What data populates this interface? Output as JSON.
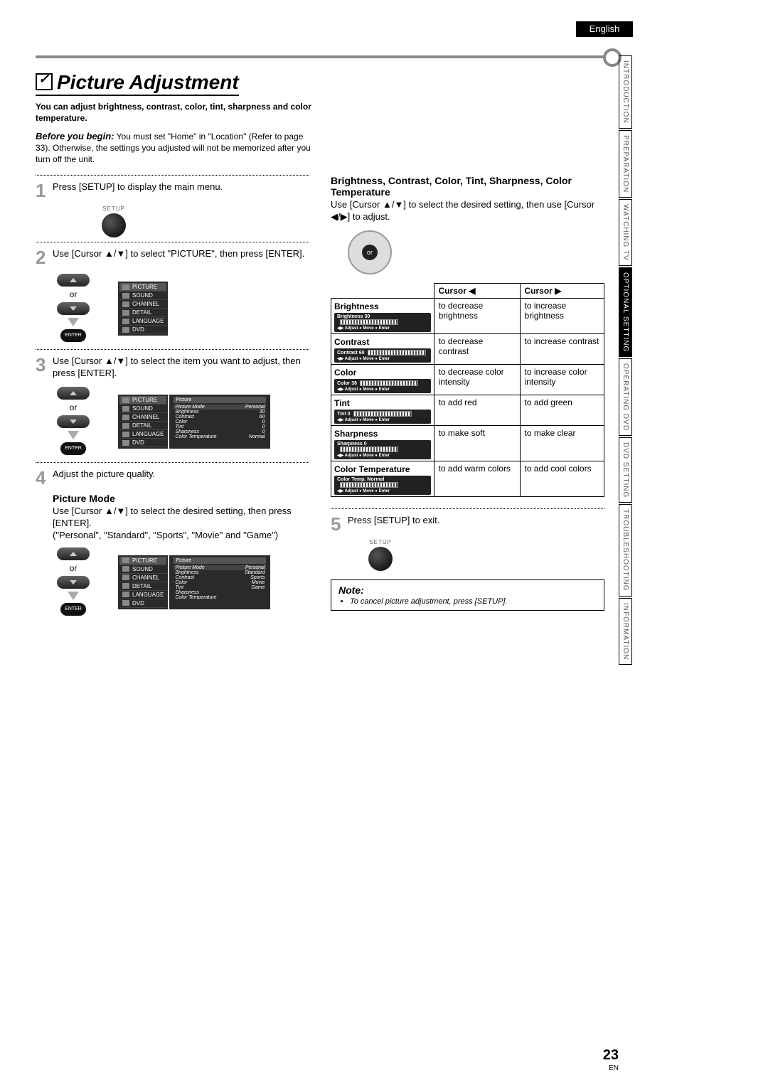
{
  "language": "English",
  "side_tabs": [
    "INTRODUCTION",
    "PREPARATION",
    "WATCHING TV",
    "OPTIONAL SETTING",
    "OPERATING DVD",
    "DVD SETTING",
    "TROUBLESHOOTING",
    "INFORMATION"
  ],
  "active_tab_index": 3,
  "title": "Picture Adjustment",
  "intro": "You can adjust brightness, contrast, color, tint, sharpness and color temperature.",
  "before_label": "Before you begin:",
  "before_text": "You must set \"Home\" in \"Location\" (Refer to page 33). Otherwise, the settings you adjusted will not be memorized after you turn off the unit.",
  "steps": {
    "s1": "Press [SETUP] to display the main menu.",
    "s2": "Use [Cursor ▲/▼] to select \"PICTURE\", then press [ENTER].",
    "s3": "Use [Cursor ▲/▼] to select the item you want to adjust, then press [ENTER].",
    "s4": "Adjust the picture quality.",
    "s5": "Press [SETUP] to exit."
  },
  "setup_label": "SETUP",
  "enter_label": "ENTER",
  "or": "or",
  "picture_mode_title": "Picture Mode",
  "picture_mode_desc1": "Use [Cursor ▲/▼] to select the desired setting, then press [ENTER].",
  "picture_mode_desc2": "(\"Personal\", \"Standard\", \"Sports\", \"Movie\" and \"Game\")",
  "right_title": "Brightness, Contrast, Color, Tint, Sharpness, Color Temperature",
  "right_desc": "Use [Cursor ▲/▼] to select the desired setting, then use [Cursor ◀/▶] to adjust.",
  "table_headers": {
    "left": "Cursor ◀",
    "right": "Cursor ▶"
  },
  "rows": [
    {
      "name": "Brightness",
      "val": "30",
      "left": "to decrease brightness",
      "right": "to increase brightness"
    },
    {
      "name": "Contrast",
      "val": "60",
      "left": "to decrease contrast",
      "right": "to increase contrast"
    },
    {
      "name": "Color",
      "val": "36",
      "left": "to decrease color intensity",
      "right": "to increase color intensity"
    },
    {
      "name": "Tint",
      "val": "0",
      "left": "to add red",
      "right": "to add green"
    },
    {
      "name": "Sharpness",
      "val": "0",
      "left": "to make soft",
      "right": "to make clear"
    },
    {
      "name": "Color Temperature",
      "val": "Normal",
      "label": "Color Temp.",
      "left": "to add warm colors",
      "right": "to add cool colors"
    }
  ],
  "slider_ctl": {
    "adjust": "Adjust",
    "move": "Move",
    "enter": "Enter"
  },
  "osd_menu": [
    "PICTURE",
    "SOUND",
    "CHANNEL",
    "DETAIL",
    "LANGUAGE",
    "DVD"
  ],
  "osd_picture": {
    "head": "Picture",
    "items": [
      {
        "k": "Picture Mode",
        "v": "Personal"
      },
      {
        "k": "Brightness",
        "v": "30"
      },
      {
        "k": "Contrast",
        "v": "60"
      },
      {
        "k": "Color",
        "v": "0"
      },
      {
        "k": "Tint",
        "v": "0"
      },
      {
        "k": "Sharpness",
        "v": "0"
      },
      {
        "k": "Color Temperature",
        "v": "Normal"
      }
    ]
  },
  "osd_modes": [
    "Personal",
    "Standard",
    "Sports",
    "Movie",
    "Game"
  ],
  "note_title": "Note:",
  "note_item": "To cancel picture adjustment, press [SETUP].",
  "page_number": "23",
  "page_lang": "EN"
}
